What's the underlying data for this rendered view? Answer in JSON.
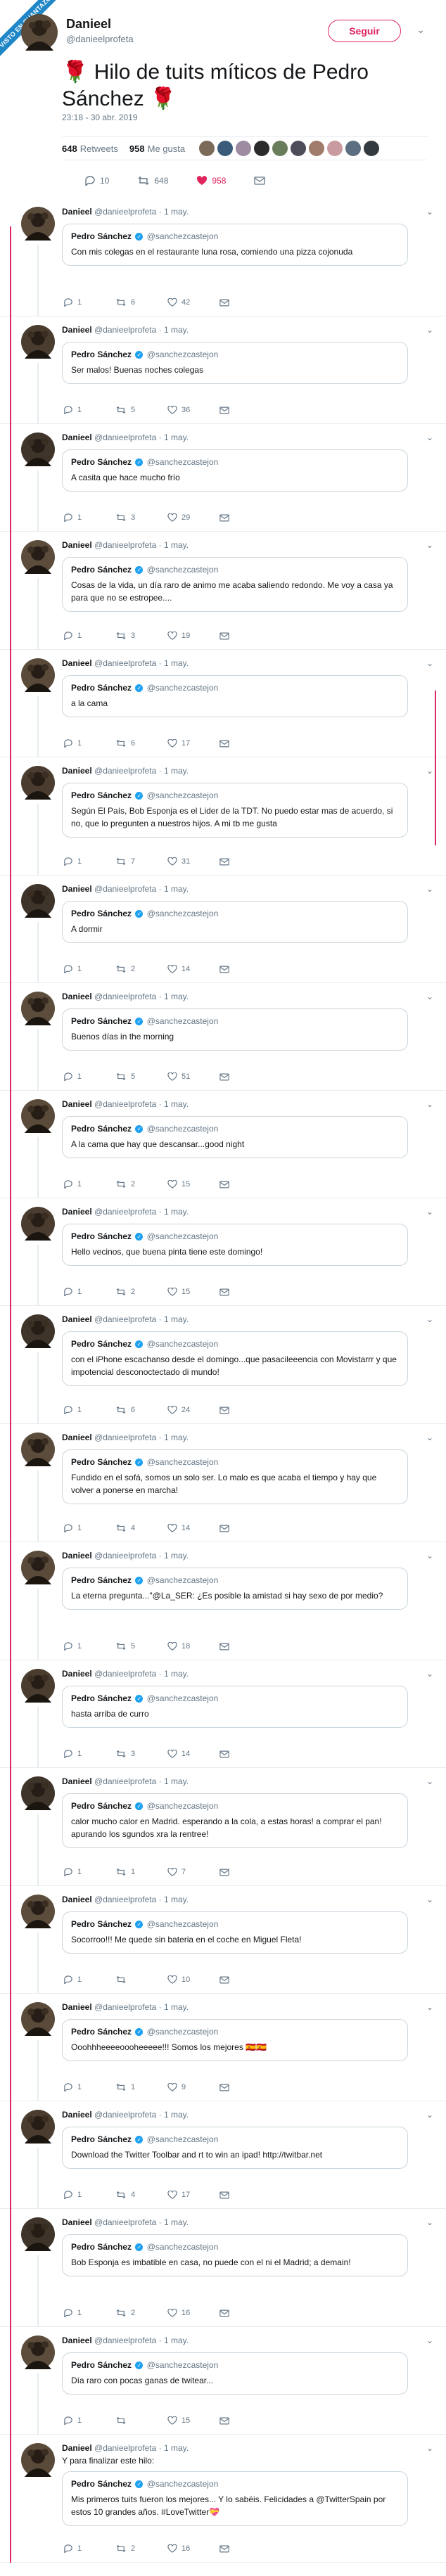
{
  "badge": "VISTO EN CUANTAZO",
  "header": {
    "name": "Danieel",
    "handle": "@danieelprofeta",
    "follow_label": "Seguir"
  },
  "main_tweet": {
    "rose_left": "🌹",
    "text": "Hilo de tuits míticos de Pedro Sánchez",
    "rose_right": "🌹",
    "meta": "23:18 - 30 abr. 2019",
    "retweets_count": "648",
    "retweets_label": "Retweets",
    "likes_count": "958",
    "likes_label": "Me gusta",
    "actions": {
      "replies": "10",
      "retweets": "648",
      "likes": "958"
    }
  },
  "colors": {
    "accent": "#e0245e",
    "link": "#1da1f2",
    "muted": "#657786",
    "border": "#e6ecf0"
  },
  "replies": [
    {
      "author": "Danieel",
      "handle": "@danieelprofeta · 1 may.",
      "quote_author": "Pedro Sánchez",
      "quote_handle": "@sanchezcastejon",
      "text": "Con mis colegas en el restaurante luna rosa, comiendo una pizza cojonuda",
      "replies": "1",
      "retweets": "6",
      "likes": "42"
    },
    {
      "author": "Danieel",
      "handle": "@danieelprofeta · 1 may.",
      "quote_author": "Pedro Sánchez",
      "quote_handle": "@sanchezcastejon",
      "text": "Ser malos! Buenas noches colegas",
      "replies": "1",
      "retweets": "5",
      "likes": "36"
    },
    {
      "author": "Danieel",
      "handle": "@danieelprofeta · 1 may.",
      "quote_author": "Pedro Sánchez",
      "quote_handle": "@sanchezcastejon",
      "text": "A casita que hace mucho frío",
      "replies": "1",
      "retweets": "3",
      "likes": "29"
    },
    {
      "author": "Danieel",
      "handle": "@danieelprofeta · 1 may.",
      "quote_author": "Pedro Sánchez",
      "quote_handle": "@sanchezcastejon",
      "text": "Cosas de la vida, un día raro de animo me acaba saliendo redondo. Me voy a casa ya para que no se estropee....",
      "replies": "1",
      "retweets": "3",
      "likes": "19"
    },
    {
      "author": "Danieel",
      "handle": "@danieelprofeta · 1 may.",
      "quote_author": "Pedro Sánchez",
      "quote_handle": "@sanchezcastejon",
      "text": "a la cama",
      "replies": "1",
      "retweets": "6",
      "likes": "17"
    },
    {
      "author": "Danieel",
      "handle": "@danieelprofeta · 1 may.",
      "quote_author": "Pedro Sánchez",
      "quote_handle": "@sanchezcastejon",
      "text": "Según El País, Bob Esponja es el Lider de la TDT. No puedo estar mas de acuerdo, si no, que lo pregunten a nuestros hijos. A mi tb me gusta",
      "replies": "1",
      "retweets": "7",
      "likes": "31"
    },
    {
      "author": "Danieel",
      "handle": "@danieelprofeta · 1 may.",
      "quote_author": "Pedro Sánchez",
      "quote_handle": "@sanchezcastejon",
      "text": "A dormir",
      "replies": "1",
      "retweets": "2",
      "likes": "14"
    },
    {
      "author": "Danieel",
      "handle": "@danieelprofeta · 1 may.",
      "quote_author": "Pedro Sánchez",
      "quote_handle": "@sanchezcastejon",
      "text": "Buenos días in the morning",
      "replies": "1",
      "retweets": "5",
      "likes": "51"
    },
    {
      "author": "Danieel",
      "handle": "@danieelprofeta · 1 may.",
      "quote_author": "Pedro Sánchez",
      "quote_handle": "@sanchezcastejon",
      "text": "A la cama que hay que descansar...good night",
      "replies": "1",
      "retweets": "2",
      "likes": "15"
    },
    {
      "author": "Danieel",
      "handle": "@danieelprofeta · 1 may.",
      "quote_author": "Pedro Sánchez",
      "quote_handle": "@sanchezcastejon",
      "text": "Hello vecinos, que buena pinta tiene este domingo!",
      "replies": "1",
      "retweets": "2",
      "likes": "15"
    },
    {
      "author": "Danieel",
      "handle": "@danieelprofeta · 1 may.",
      "quote_author": "Pedro Sánchez",
      "quote_handle": "@sanchezcastejon",
      "text": "con el iPhone escachanso desde el domingo...que pasacileeencia con Movistarrr y que impotencial desconoctectado di mundo!",
      "replies": "1",
      "retweets": "6",
      "likes": "24"
    },
    {
      "author": "Danieel",
      "handle": "@danieelprofeta · 1 may.",
      "quote_author": "Pedro Sánchez",
      "quote_handle": "@sanchezcastejon",
      "text": "Fundido en el sofá, somos un solo ser. Lo malo es que acaba el tiempo y hay que volver a ponerse en marcha!",
      "replies": "1",
      "retweets": "4",
      "likes": "14"
    },
    {
      "author": "Danieel",
      "handle": "@danieelprofeta · 1 may.",
      "quote_author": "Pedro Sánchez",
      "quote_handle": "@sanchezcastejon",
      "text": "La eterna pregunta...\"@La_SER: ¿Es posible la amistad si hay sexo de por medio?",
      "replies": "1",
      "retweets": "5",
      "likes": "18"
    },
    {
      "author": "Danieel",
      "handle": "@danieelprofeta · 1 may.",
      "quote_author": "Pedro Sánchez",
      "quote_handle": "@sanchezcastejon",
      "text": "hasta arriba de curro",
      "replies": "1",
      "retweets": "3",
      "likes": "14"
    },
    {
      "author": "Danieel",
      "handle": "@danieelprofeta · 1 may.",
      "quote_author": "Pedro Sánchez",
      "quote_handle": "@sanchezcastejon",
      "text": "calor mucho calor en Madrid. esperando a la cola, a estas horas! a comprar el pan! apurando los sgundos xra la rentree!",
      "replies": "1",
      "retweets": "1",
      "likes": "7"
    },
    {
      "author": "Danieel",
      "handle": "@danieelprofeta · 1 may.",
      "quote_author": "Pedro Sánchez",
      "quote_handle": "@sanchezcastejon",
      "text": "Socorroo!!! Me quede sin bateria en el coche en Miguel Fleta!",
      "replies": "1",
      "retweets": "",
      "likes": "10"
    },
    {
      "author": "Danieel",
      "handle": "@danieelprofeta · 1 may.",
      "quote_author": "Pedro Sánchez",
      "quote_handle": "@sanchezcastejon",
      "text": "Ooohhheeeeoooheeeee!!! Somos los mejores 🇪🇸🇪🇸",
      "replies": "1",
      "retweets": "1",
      "likes": "9"
    },
    {
      "author": "Danieel",
      "handle": "@danieelprofeta · 1 may.",
      "quote_author": "Pedro Sánchez",
      "quote_handle": "@sanchezcastejon",
      "text": "Download the Twitter Toolbar and rt to win an ipad! http://twitbar.net",
      "replies": "1",
      "retweets": "4",
      "likes": "17"
    },
    {
      "author": "Danieel",
      "handle": "@danieelprofeta · 1 may.",
      "quote_author": "Pedro Sánchez",
      "quote_handle": "@sanchezcastejon",
      "text": "Bob Esponja es imbatible en casa, no puede con el ni el Madrid; a demain!",
      "replies": "1",
      "retweets": "2",
      "likes": "16"
    },
    {
      "author": "Danieel",
      "handle": "@danieelprofeta · 1 may.",
      "quote_author": "Pedro Sánchez",
      "quote_handle": "@sanchezcastejon",
      "text": "Día raro con pocas ganas de twitear...",
      "replies": "1",
      "retweets": "",
      "likes": "15"
    },
    {
      "author": "Danieel",
      "handle": "@danieelprofeta · 1 may.",
      "intro": "Y para finalizar este hilo:",
      "quote_author": "Pedro Sánchez",
      "quote_handle": "@sanchezcastejon",
      "text": "Mis primeros tuits fueron los mejores... Y lo sabéis. Felicidades a @TwitterSpain por estos 10 grandes años. #LoveTwitter💝",
      "replies": "1",
      "retweets": "2",
      "likes": "16"
    }
  ]
}
